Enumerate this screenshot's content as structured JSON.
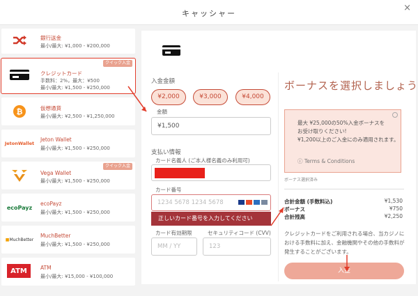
{
  "header": {
    "title": "キャッシャー",
    "close_label": "×"
  },
  "sidebar": {
    "items": [
      {
        "name": "銀行送金",
        "limit": "最小/最大: ¥1,000 - ¥200,000",
        "icon": "shuffle-icon"
      },
      {
        "name": "クレジットカード",
        "fee": "手数料：2%，最大：¥500",
        "limit": "最小/最大: ¥1,500 - ¥250,000",
        "badge": "クイック入金",
        "icon": "credit-card-icon"
      },
      {
        "name": "仮想通貨",
        "limit": "最小/最大: ¥2,500 - ¥1,250,000",
        "icon": "bitcoin-icon"
      },
      {
        "name": "Jeton Wallet",
        "limit": "最小/最大: ¥1,500 - ¥250,000",
        "logo": "JetonWallet"
      },
      {
        "name": "Vega Wallet",
        "limit": "最小/最大: ¥1,500 - ¥250,000",
        "badge": "クイック入金",
        "icon": "vega-icon"
      },
      {
        "name": "ecoPayz",
        "limit": "最小/最大: ¥1,500 - ¥250,000",
        "logo": "ecoPayz"
      },
      {
        "name": "MuchBetter",
        "limit": "最小/最大: ¥1,500 - ¥250,000",
        "logo": "MuchBetter"
      },
      {
        "name": "ATM",
        "limit": "最小/最大: ¥15,000 - ¥100,000",
        "logo": "ATM"
      }
    ]
  },
  "deposit": {
    "amount_label": "入金金額",
    "quick_amounts": [
      "¥2,000",
      "¥3,000",
      "¥4,000"
    ],
    "amount_field_label": "金額",
    "amount_value": "¥1,500",
    "payment_info_label": "支払い情報",
    "cardholder_label": "カード名義人 (ご本人様名義のみ利用可)",
    "card_number_label": "カード番号",
    "card_number_placeholder": "1234 5678 1234 5678",
    "card_error": "正しいカード番号を入力してください",
    "expiry_label": "カード有効期限",
    "expiry_mm": "MM",
    "expiry_sep": "/",
    "expiry_yy": "YY",
    "cvv_label": "セキュリティコード (CVV)",
    "cvv_placeholder": "123"
  },
  "bonus": {
    "title": "ボーナスを選択しましょう",
    "line1": "最大 ¥25,000の50%入金ボーナスを",
    "line2": "お受け取りください!",
    "line3": "¥1,200以上のご入金にのみ適用されます。",
    "terms": "Terms & Conditions",
    "selected_label": "ボーナス選択済み"
  },
  "summary": {
    "total_label": "合計金額 (手数料込)",
    "total_value": "¥1,530",
    "bonus_label": "ボーナス",
    "bonus_value": "¥750",
    "balance_label": "合計残高",
    "balance_value": "¥2,250"
  },
  "note": "クレジットカードをご利用される場合、当カジノにおける手数料に加え、金融機関やその他の手数料が発生することがございます。",
  "deposit_button": "入金",
  "colors": {
    "accent": "#c54a36",
    "error": "#a4343a",
    "button": "#eea898",
    "highlight": "#e23c2a"
  }
}
